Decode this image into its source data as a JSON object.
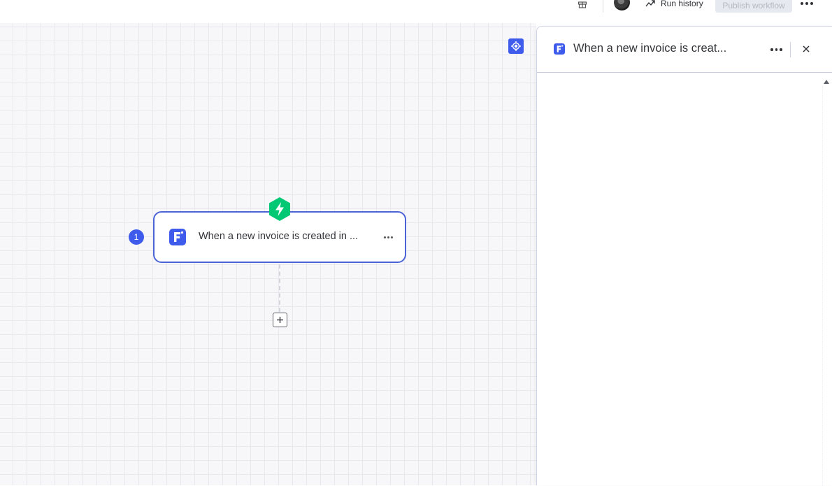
{
  "topbar": {
    "gift_icon": "gift-icon",
    "run_history_label": "Run history",
    "publish_label": "Publish workflow",
    "more_icon": "more-horizontal-icon"
  },
  "canvas": {
    "recenter_icon": "crosshair-icon",
    "step_number": "1",
    "node_title": "When a new invoice is created in ...",
    "trigger_icon": "lightning-bolt-icon",
    "add_icon": "plus-square-icon"
  },
  "panel": {
    "title": "When a new invoice is creat...",
    "close_icon": "close-icon"
  },
  "colors": {
    "accent": "#3e5bec",
    "trigger": "#00c875",
    "node_border": "#4a63d6"
  }
}
